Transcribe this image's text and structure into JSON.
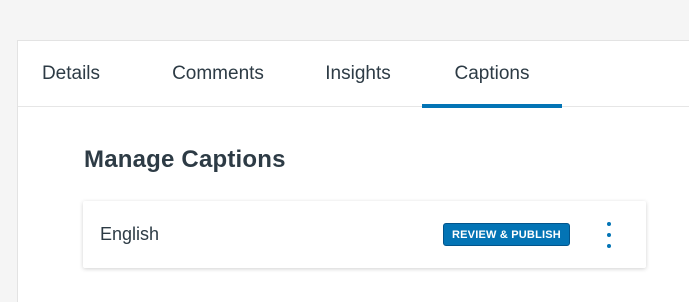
{
  "tabs": [
    {
      "label": "Details",
      "active": false
    },
    {
      "label": "Comments",
      "active": false
    },
    {
      "label": "Insights",
      "active": false
    },
    {
      "label": "Captions",
      "active": true
    }
  ],
  "main": {
    "heading": "Manage Captions",
    "captions": [
      {
        "language": "English",
        "action_label": "REVIEW & PUBLISH",
        "menu_icon": "kebab-menu-icon"
      }
    ]
  },
  "colors": {
    "accent": "#0374b5",
    "text": "#2d3b45",
    "background": "#f5f5f5"
  }
}
